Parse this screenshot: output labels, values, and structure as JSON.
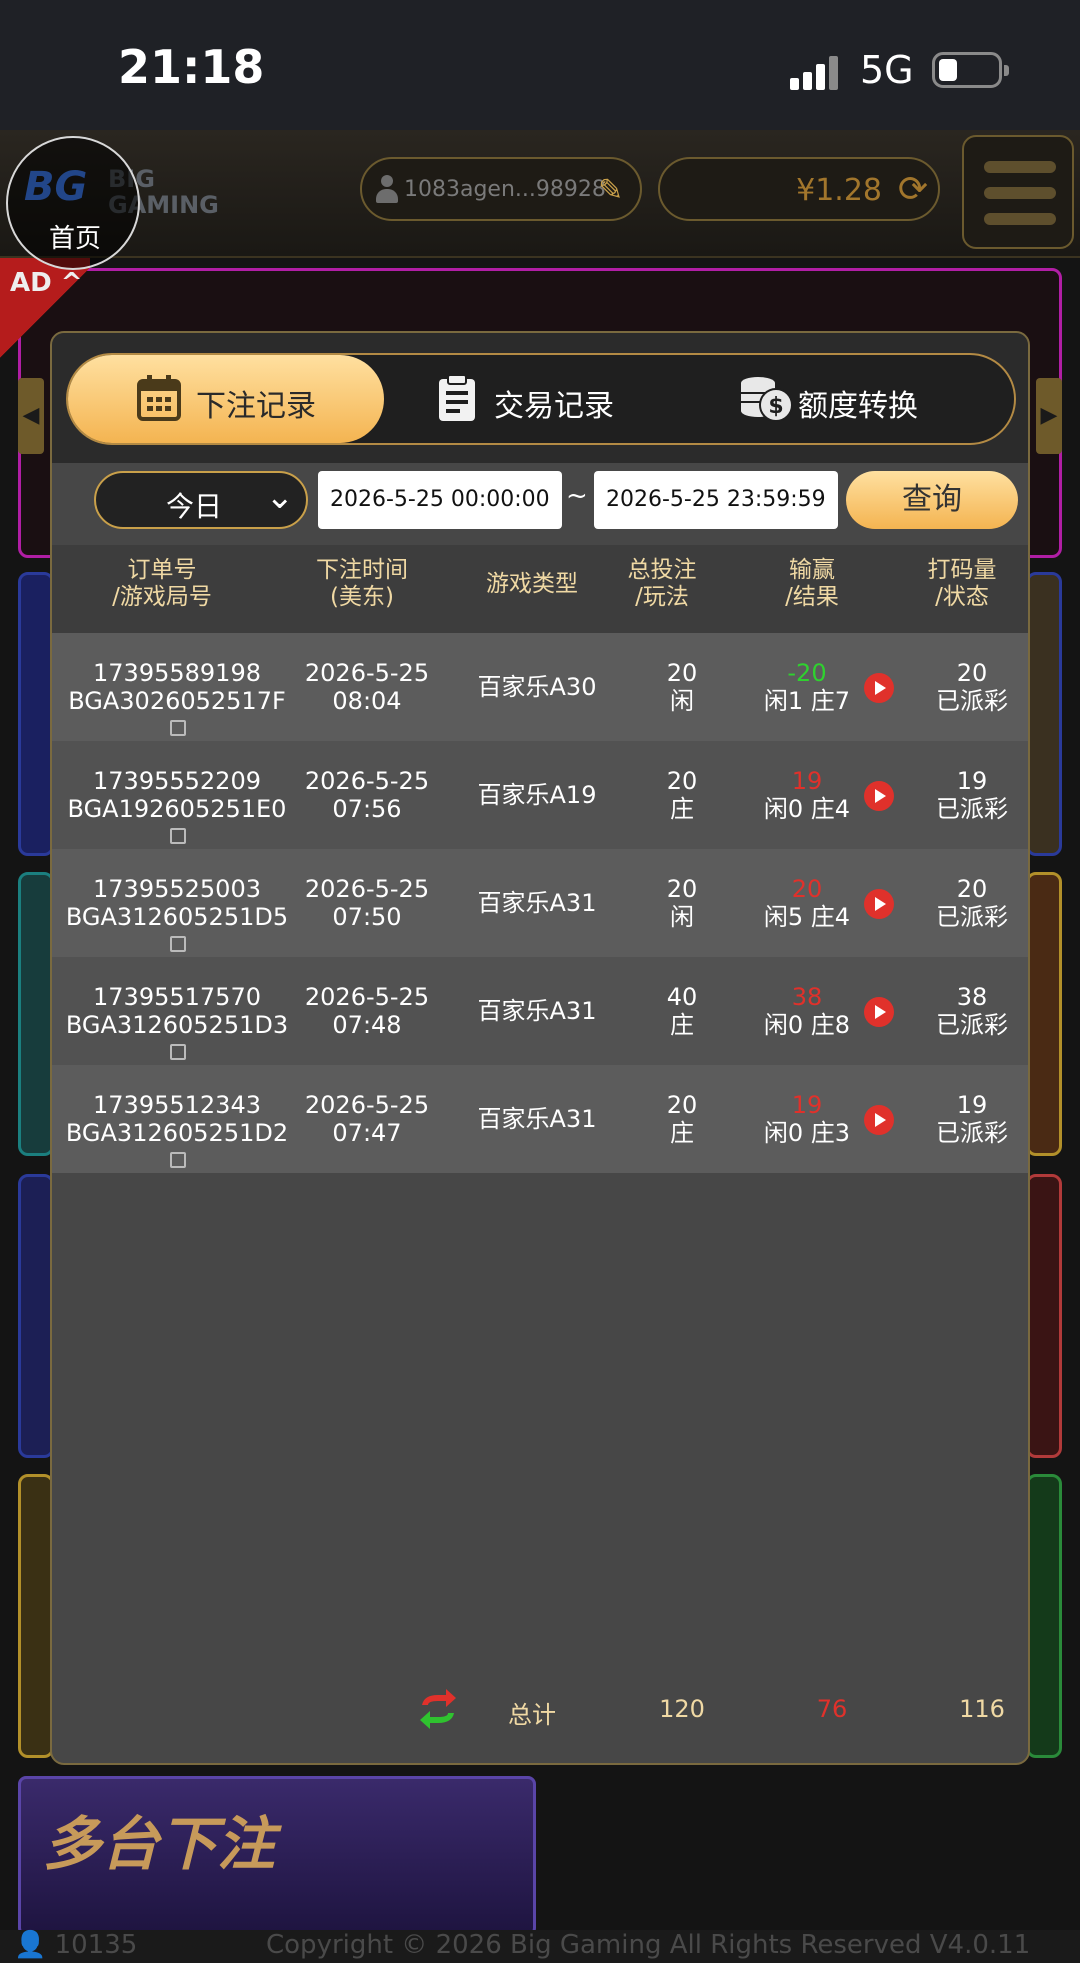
{
  "status_bar": {
    "time": "21:18",
    "network": "5G"
  },
  "header": {
    "home_label": "首页",
    "home_logo": "BG",
    "brand_line1": "BIG",
    "brand_line2": "GAMING",
    "username": "1083agen...98928",
    "balance": "¥1.28"
  },
  "background": {
    "ad_label": "AD ^",
    "promo_title": "多台下注",
    "footer_count": "10135",
    "footer_copyright": "Copyright © 2026 Big Gaming All Rights Reserved   V4.0.11"
  },
  "tabs": [
    {
      "label": "下注记录",
      "icon": "calendar-icon",
      "active": true
    },
    {
      "label": "交易记录",
      "icon": "clipboard-icon",
      "active": false
    },
    {
      "label": "额度转换",
      "icon": "coins-icon",
      "active": false
    }
  ],
  "filter": {
    "period": "今日",
    "start": "2026-5-25 00:00:00",
    "separator": "~",
    "end": "2026-5-25 23:59:59",
    "query_label": "查询"
  },
  "columns": [
    {
      "l1": "订单号",
      "l2": "/游戏局号"
    },
    {
      "l1": "下注时间",
      "l2": "(美东)"
    },
    {
      "l1": "游戏类型",
      "l2": ""
    },
    {
      "l1": "总投注",
      "l2": "/玩法"
    },
    {
      "l1": "输赢",
      "l2": "/结果"
    },
    {
      "l1": "打码量",
      "l2": "/状态"
    }
  ],
  "rows": [
    {
      "order": "17395589198",
      "round": "BGA3026052517F",
      "date": "2026-5-25",
      "time": "08:04",
      "game": "百家乐A30",
      "bet": "20",
      "play": "闲",
      "winloss": "-20",
      "result": "闲1 庄7",
      "volume": "20",
      "status": "已派彩"
    },
    {
      "order": "17395552209",
      "round": "BGA192605251E0",
      "date": "2026-5-25",
      "time": "07:56",
      "game": "百家乐A19",
      "bet": "20",
      "play": "庄",
      "winloss": "19",
      "result": "闲0 庄4",
      "volume": "19",
      "status": "已派彩"
    },
    {
      "order": "17395525003",
      "round": "BGA312605251D5",
      "date": "2026-5-25",
      "time": "07:50",
      "game": "百家乐A31",
      "bet": "20",
      "play": "闲",
      "winloss": "20",
      "result": "闲5 庄4",
      "volume": "20",
      "status": "已派彩"
    },
    {
      "order": "17395517570",
      "round": "BGA312605251D3",
      "date": "2026-5-25",
      "time": "07:48",
      "game": "百家乐A31",
      "bet": "40",
      "play": "庄",
      "winloss": "38",
      "result": "闲0 庄8",
      "volume": "38",
      "status": "已派彩"
    },
    {
      "order": "17395512343",
      "round": "BGA312605251D2",
      "date": "2026-5-25",
      "time": "07:47",
      "game": "百家乐A31",
      "bet": "20",
      "play": "庄",
      "winloss": "19",
      "result": "闲0 庄3",
      "volume": "19",
      "status": "已派彩"
    }
  ],
  "totals": {
    "label": "总计",
    "bet": "120",
    "winloss": "76",
    "volume": "116"
  },
  "colors": {
    "accent": "#f4b451",
    "gold_text": "#f0d9a4",
    "loss": "#2fd12f",
    "win": "#e0312b"
  }
}
